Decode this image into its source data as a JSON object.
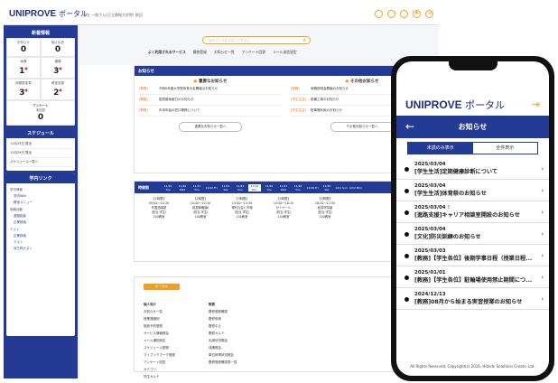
{
  "desktop": {
    "brand": "UNIPROVE",
    "brand_sub": "ポータル",
    "user": "日立 一郎さん(日立情報大学院) 前回",
    "side_new_title": "新着情報",
    "side_counts": [
      {
        "label": "お知らせ",
        "value": "0"
      },
      {
        "label": "個人伝言",
        "value": "0"
      },
      {
        "label": "休講",
        "value": "1",
        "badge": "●"
      },
      {
        "label": "補講",
        "value": "3",
        "badge": "●"
      },
      {
        "label": "時間割変更",
        "value": "3",
        "badge": "●"
      },
      {
        "label": "教室変更",
        "value": "2",
        "badge": "●"
      }
    ],
    "questionnaire_label": "アンケート",
    "questionnaire_sub": "未回答",
    "questionnaire_value": "0",
    "schedule_title": "スケジュール",
    "schedule_items": [
      "11月29日 提出",
      "11月29日 提出",
      "スケジュール一覧へ"
    ],
    "links_title": "学内リンク",
    "side_links": [
      {
        "head": "学内情報",
        "items": [
          "学内Wiki",
          "教室メニュー"
        ]
      },
      {
        "head": "就職活動",
        "items": [
          "進路相談",
          "企業検索"
        ]
      },
      {
        "head": "テスト",
        "items": [
          "企業検索",
          "テスト",
          "持ち物テスト"
        ]
      }
    ],
    "search_placeholder": "キーワードを入力して下さい",
    "services_title": "よく利用されるサービス",
    "services": [
      "履修登録",
      "お知らせ一覧",
      "アンケート回答",
      "メール送信設定"
    ],
    "notice_title": "お知らせ",
    "important_title": "重要なお知らせ",
    "other_title": "その他お知らせ",
    "important": [
      {
        "tag": "[教務]",
        "text": "令和6年度大学院体育大会開催のお知らせ"
      },
      {
        "tag": "[教務]",
        "text": "図書館休館日のお知らせ"
      },
      {
        "tag": "[教務]",
        "text": "年末年始の窓口業務について"
      }
    ],
    "others": [
      {
        "tag": "[就職]",
        "text": "就職説明会開催のお知らせ"
      },
      {
        "tag": "[学生生活]",
        "text": "設備工事のお知らせ"
      },
      {
        "tag": "[学生生活]",
        "text": "駐車場利用のお知らせ"
      }
    ],
    "important_more": "重要なお知らせ一覧へ",
    "other_more": "その他お知らせ一覧へ",
    "timetable_label": "時間割",
    "days": [
      "11/19 Tue",
      "11/20 Wed",
      "11/21 Thu",
      "11/22 Fri",
      "11/23 Sat",
      "11/24 Sun",
      "11/25 Mon",
      "11/26 Tue",
      "11/27 Wed",
      "11/28 Thu",
      "11/29 Fri",
      "11/30 Sat",
      "12/1 Sun",
      "12/2 Mon"
    ],
    "periods": [
      {
        "p": "【1時限】",
        "t": "09:00〜10:30",
        "c": "外国語講読",
        "r": "(担当 学生)",
        "room": "100教室"
      },
      {
        "p": "【2時限】",
        "t": "10:40〜12:10",
        "c": "経営戦略論Ⅱ",
        "r": "(担当 学生)",
        "room": "100教室"
      },
      {
        "p": "【3時限】",
        "t": "13:00〜14:30",
        "c": "現代社会と市場",
        "r": "(担当 学生)",
        "room": "100教室"
      },
      {
        "p": "【4時限】",
        "t": "14:40〜16:10",
        "c": "ゼミナール",
        "r": "(担当 学生)",
        "room": "100教室"
      },
      {
        "p": "【5時限】",
        "t": "16:20〜17:50",
        "c": "経済学特論",
        "r": "(担当 学生)",
        "room": "100教室"
      }
    ],
    "portal_button": "ポータル",
    "link_cols": [
      {
        "head": "個人向け",
        "items": [
          "お知らせ一覧",
          "授業連絡別",
          "施設予約登録",
          "サービス情報照会",
          "メール通知設定",
          "スケジュール登録",
          "マイブックマーク登録",
          "アンケート回答",
          "カテゴリ",
          "学生カルテ"
        ]
      },
      {
        "head": "教務",
        "items": [
          "履修登録確認",
          "履修申請",
          "履修中止",
          "履修カルテ",
          "出席状況照会",
          "成績照会",
          "単位修得状況照会",
          "履修登録確認表一覧"
        ]
      }
    ]
  },
  "phone": {
    "brand": "UNIPROVE",
    "brand_sub": "ポータル",
    "title": "お知らせ",
    "tab_unread": "未読のみ表示",
    "tab_all": "全件表示",
    "items": [
      {
        "date": "2025/03/04",
        "text": "[学生生活]定期健康診断について",
        "new": ""
      },
      {
        "date": "2025/03/04",
        "text": "[学生生活]体育祭のお知らせ",
        "new": ""
      },
      {
        "date": "2025/03/04",
        "text": "[進路支援]キャリア相談室開設のお知らせ",
        "new": "!"
      },
      {
        "date": "2025/03/04",
        "text": "[文化]防災訓練のお知らせ",
        "new": ""
      },
      {
        "date": "2025/03/03",
        "text": "[教務]【学生各位】後期学事日程（授業日程...",
        "new": ""
      },
      {
        "date": "2025/01/01",
        "text": "[教務]【学生各位】駐輪場使用禁止期間につ...",
        "new": ""
      },
      {
        "date": "2024/12/13",
        "text": "[教務]08月から始まる実習授業のお知らせ",
        "new": ""
      }
    ],
    "footer": "All Rights Reserved, Copyright(c) 2016, Hitachi Solutions Create, Ltd."
  }
}
